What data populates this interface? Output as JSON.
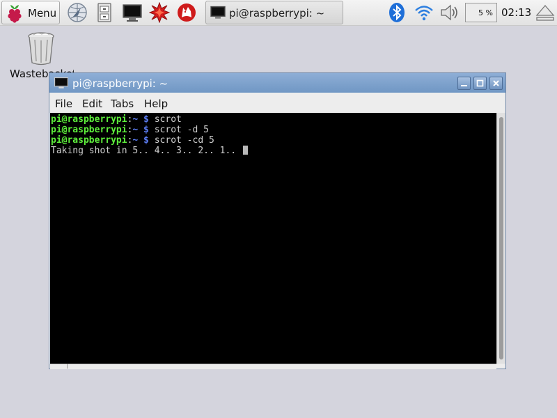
{
  "panel": {
    "menu_label": "Menu",
    "launchers": [
      {
        "icon": "web-browser-icon"
      },
      {
        "icon": "file-manager-icon"
      },
      {
        "icon": "terminal-icon"
      },
      {
        "icon": "mathematica-icon"
      },
      {
        "icon": "wolfram-icon"
      }
    ],
    "taskbar_window": {
      "icon": "terminal-icon",
      "title": "pi@raspberrypi: ~"
    },
    "tray": {
      "bluetooth": "bluetooth-icon",
      "wifi": "wifi-icon",
      "volume": "volume-icon",
      "cpu_usage": "5 %",
      "clock": "02:13",
      "eject": "eject-icon"
    }
  },
  "desktop": {
    "icons": [
      {
        "label": "Wastebasket",
        "icon": "trash-icon"
      }
    ]
  },
  "window": {
    "title": "pi@raspberrypi: ~",
    "controls": [
      "minimize-icon",
      "maximize-icon",
      "close-icon"
    ],
    "menu": [
      "File",
      "Edit",
      "Tabs",
      "Help"
    ],
    "terminal": {
      "lines": [
        {
          "user": "pi@raspberrypi",
          "sep": ":",
          "path": "~",
          "prompt": " $ ",
          "command": "scrot"
        },
        {
          "user": "pi@raspberrypi",
          "sep": ":",
          "path": "~",
          "prompt": " $ ",
          "command": "scrot -d 5"
        },
        {
          "user": "pi@raspberrypi",
          "sep": ":",
          "path": "~",
          "prompt": " $ ",
          "command": "scrot -cd 5"
        }
      ],
      "output": "Taking shot in 5.. 4.. 3.. 2.. 1.. "
    }
  },
  "colors": {
    "desktop_bg": "#d4d4dd",
    "titlebar": "#7a9dc9",
    "prompt_user": "#5ef03c",
    "prompt_path": "#5c7df5",
    "terminal_bg": "#000000"
  }
}
